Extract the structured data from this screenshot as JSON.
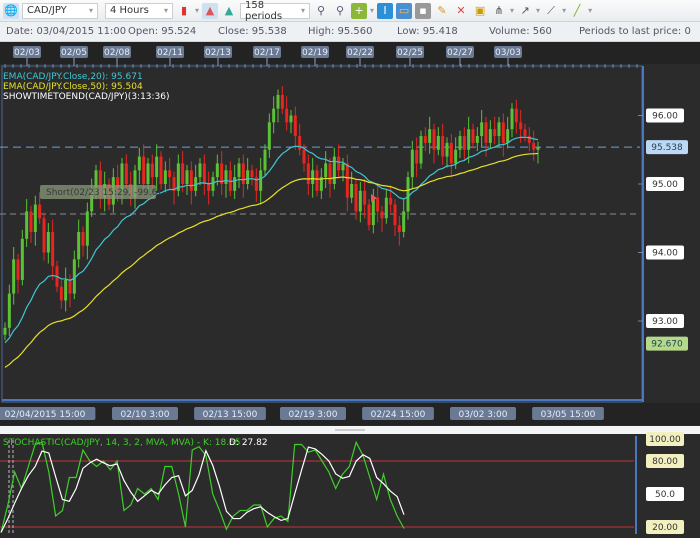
{
  "toolbar": {
    "symbol": "CAD/JPY",
    "timeframe": "4 Hours",
    "periods": "158 periods"
  },
  "info": {
    "date": "Date: 03/04/2015 11:00",
    "open": "Open: 95.524",
    "close": "Close: 95.538",
    "high": "High: 95.560",
    "low": "Low: 95.418",
    "volume": "Volume: 560",
    "periods_to_last": "Periods to last price: 0"
  },
  "legend": {
    "ema20": "EMA(CAD/JPY.Close,20): 95.671",
    "ema50": "EMA(CAD/JPY.Close,50): 95.504",
    "timetoend": "SHOWTIMETOEND(CAD/JPY)(3:13:36)"
  },
  "annotation": {
    "short": "Short(02/23 15:29, -99.6)"
  },
  "top_dates": [
    "02/03",
    "02/05",
    "02/08",
    "02/11",
    "02/13",
    "02/17",
    "02/19",
    "02/22",
    "02/25",
    "02/27",
    "03/03"
  ],
  "bottom_dates": [
    "02/04/2015 15:00",
    "02/10 3:00",
    "02/13 15:00",
    "02/19 3:00",
    "02/24 15:00",
    "03/02 3:00",
    "03/05 15:00"
  ],
  "price_scale": {
    "ticks": [
      "96.00",
      "95.00",
      "94.00",
      "93.00"
    ],
    "last_price": "95.538",
    "low_marker": "92.670"
  },
  "stoch": {
    "label": "STOCHASTIC(CAD/JPY, 14, 3, 2, MVA, MVA) - K: 18.65",
    "d_label": "D: 27.82",
    "ticks": [
      "100.00",
      "80.00",
      "50.0",
      "20.00"
    ]
  },
  "colors": {
    "up": "#5bc236",
    "down": "#e8251f",
    "ema20": "#3fc6d6",
    "ema50": "#e6e12a",
    "k": "#3fcf2a",
    "d": "#ffffff",
    "band": "#c0343a"
  },
  "chart_data": {
    "type": "candlestick",
    "closes": [
      92.9,
      93.4,
      93.9,
      93.6,
      94.2,
      94.6,
      94.3,
      94.7,
      94.5,
      94.0,
      94.3,
      93.8,
      93.5,
      93.3,
      93.6,
      93.4,
      93.9,
      94.3,
      94.1,
      94.6,
      94.9,
      95.2,
      94.8,
      95.0,
      94.7,
      95.1,
      94.9,
      95.3,
      95.0,
      94.8,
      95.2,
      95.4,
      95.0,
      95.3,
      95.1,
      95.4,
      95.0,
      95.2,
      95.1,
      94.9,
      95.3,
      95.0,
      95.2,
      94.9,
      95.1,
      95.3,
      95.0,
      94.9,
      95.1,
      95.3,
      95.0,
      95.2,
      94.9,
      95.1,
      95.3,
      95.0,
      95.2,
      95.1,
      94.9,
      95.2,
      95.5,
      95.9,
      96.1,
      96.3,
      96.1,
      95.9,
      96.0,
      95.7,
      95.5,
      95.3,
      95.0,
      95.2,
      94.9,
      95.1,
      95.3,
      95.0,
      95.4,
      95.2,
      95.3,
      94.8,
      95.0,
      94.6,
      94.9,
      94.7,
      94.4,
      94.8,
      94.6,
      94.5,
      94.8,
      94.7,
      94.4,
      94.3,
      94.6,
      95.1,
      95.5,
      95.3,
      95.7,
      95.6,
      95.8,
      95.5,
      95.7,
      95.4,
      95.6,
      95.3,
      95.5,
      95.7,
      95.5,
      95.8,
      95.6,
      95.7,
      95.9,
      95.6,
      95.8,
      95.7,
      95.9,
      95.6,
      95.8,
      96.1,
      95.9,
      95.8,
      95.7,
      95.6,
      95.5,
      95.538
    ],
    "stoch_k": [
      15,
      40,
      70,
      55,
      75,
      95,
      97,
      70,
      30,
      35,
      65,
      65,
      90,
      80,
      75,
      80,
      72,
      80,
      35,
      40,
      55,
      50,
      55,
      45,
      75,
      75,
      50,
      20,
      90,
      93,
      85,
      50,
      35,
      18,
      30,
      35,
      35,
      40,
      40,
      20,
      28,
      30,
      25,
      95,
      95,
      88,
      90,
      80,
      70,
      55,
      68,
      75,
      97,
      85,
      65,
      45,
      68,
      45,
      30,
      18.65
    ]
  }
}
